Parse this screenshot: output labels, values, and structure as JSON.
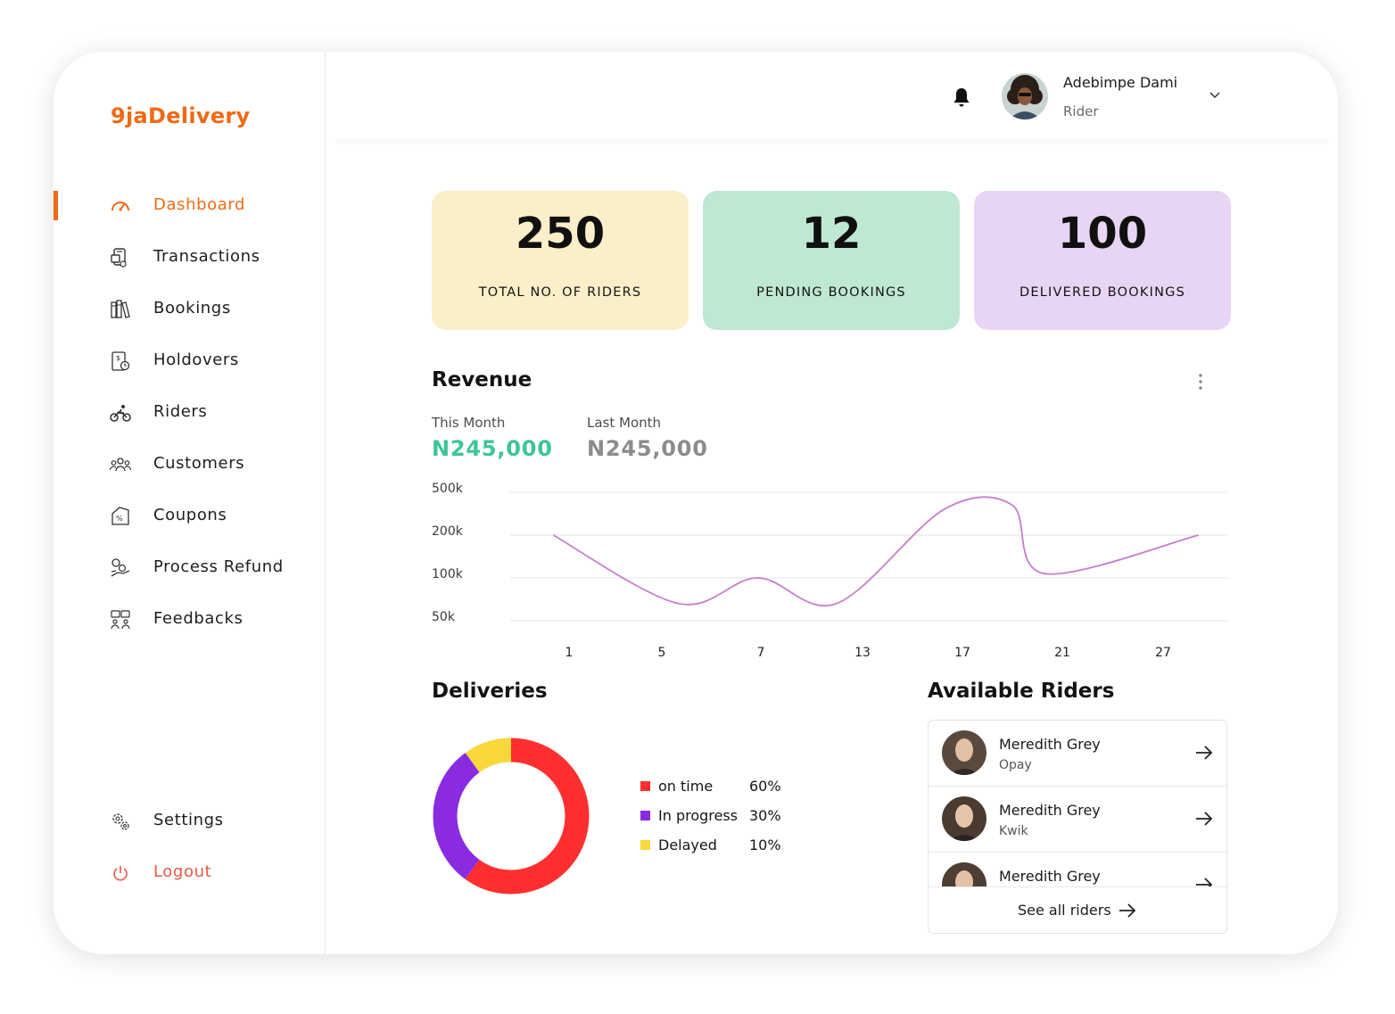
{
  "app": {
    "brand": "9jaDelivery"
  },
  "sidebar": {
    "items": [
      {
        "label": "Dashboard",
        "icon": "speedometer-icon",
        "active": true
      },
      {
        "label": "Transactions",
        "icon": "transactions-icon"
      },
      {
        "label": "Bookings",
        "icon": "bookings-icon"
      },
      {
        "label": "Holdovers",
        "icon": "holdovers-icon"
      },
      {
        "label": "Riders",
        "icon": "motorbike-icon"
      },
      {
        "label": "Customers",
        "icon": "customers-icon"
      },
      {
        "label": "Coupons",
        "icon": "coupon-icon"
      },
      {
        "label": "Process Refund",
        "icon": "refund-icon"
      },
      {
        "label": "Feedbacks",
        "icon": "feedback-icon"
      }
    ],
    "settings_label": "Settings",
    "logout_label": "Logout"
  },
  "header": {
    "user_name": "Adebimpe Dami",
    "user_role": "Rider",
    "bell_icon": "bell-icon",
    "dropdown_icon": "chevron-down-icon"
  },
  "stats": [
    {
      "value": "250",
      "label": "TOTAL NO. OF RIDERS",
      "color": "#fbefc9"
    },
    {
      "value": "12",
      "label": "PENDING BOOKINGS",
      "color": "#bfe8d2"
    },
    {
      "value": "100",
      "label": "DELIVERED BOOKINGS",
      "color": "#e8d5f3"
    }
  ],
  "revenue": {
    "title": "Revenue",
    "this_month_label": "This Month",
    "this_month_value": "N245,000",
    "last_month_label": "Last Month",
    "last_month_value": "N245,000",
    "accent_this": "#3dc596",
    "accent_last": "#8c8c8c"
  },
  "chart_data": {
    "type": "line",
    "x": [
      "1",
      "5",
      "7",
      "13",
      "17",
      "21",
      "27"
    ],
    "y_ticks": [
      "500k",
      "200k",
      "100k",
      "50k"
    ],
    "series": [
      {
        "color": "#c77ec9",
        "points": [
          {
            "x_pos": 0.06,
            "level": 2.0
          },
          {
            "x_pos": 0.235,
            "level": 0.4
          },
          {
            "x_pos": 0.345,
            "level": 1.0
          },
          {
            "x_pos": 0.455,
            "level": 0.4
          },
          {
            "x_pos": 0.605,
            "level": 2.6
          },
          {
            "x_pos": 0.7,
            "level": 2.7
          },
          {
            "x_pos": 0.745,
            "level": 1.1
          },
          {
            "x_pos": 0.96,
            "level": 2.0
          }
        ]
      }
    ],
    "grid": true
  },
  "deliveries": {
    "title": "Deliveries",
    "segments": [
      {
        "name": "on time",
        "percent": 60,
        "pct_label": "60%",
        "color": "#ff2f2f"
      },
      {
        "name": "In progress",
        "percent": 30,
        "pct_label": "30%",
        "color": "#8a2be2"
      },
      {
        "name": "Delayed",
        "percent": 10,
        "pct_label": "10%",
        "color": "#f8d83a"
      }
    ]
  },
  "riders": {
    "title": "Available Riders",
    "list": [
      {
        "name": "Meredith Grey",
        "company": "Opay"
      },
      {
        "name": "Meredith Grey",
        "company": "Kwik"
      },
      {
        "name": "Meredith Grey",
        "company": ""
      }
    ],
    "see_all_label": "See all riders"
  }
}
